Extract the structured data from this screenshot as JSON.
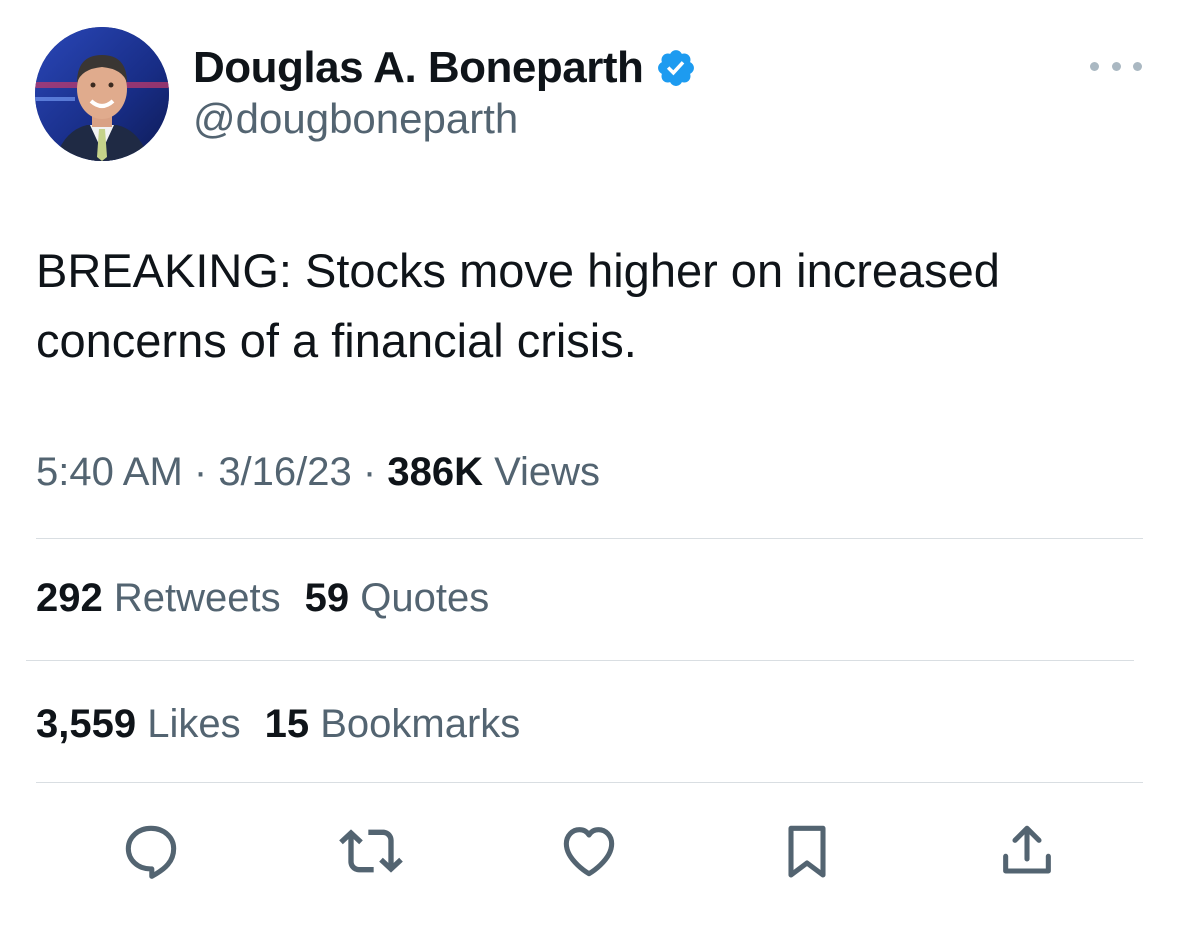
{
  "author": {
    "display_name": "Douglas A. Boneparth",
    "handle": "@dougboneparth",
    "verified_icon": "verified-badge-icon"
  },
  "tweet": {
    "text": "BREAKING: Stocks move higher on increased concerns of a financial crisis."
  },
  "meta": {
    "time": "5:40 AM",
    "sep1": " · ",
    "date": "3/16/23",
    "sep2": " · ",
    "views_count": "386K",
    "views_label": " Views"
  },
  "stats": {
    "retweets_count": "292",
    "retweets_label": " Retweets",
    "quotes_count": "59",
    "quotes_label": " Quotes",
    "likes_count": "3,559",
    "likes_label": " Likes",
    "bookmarks_count": "15",
    "bookmarks_label": " Bookmarks"
  },
  "actions": [
    "reply-icon",
    "retweet-icon",
    "like-icon",
    "bookmark-icon",
    "share-icon"
  ],
  "colors": {
    "text": "#0f1419",
    "secondary": "#536471",
    "verified": "#1d9bf0",
    "divider": "#d9dee2",
    "icon": "#536471"
  }
}
